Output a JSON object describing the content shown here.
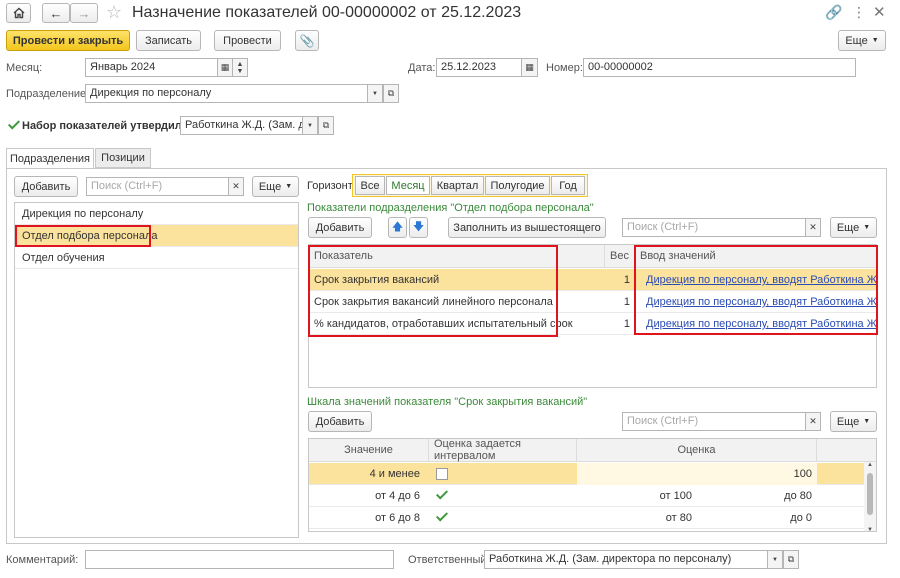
{
  "window": {
    "title": "Назначение показателей 00-00000002 от 25.12.2023"
  },
  "toolbar": {
    "post_close": "Провести и закрыть",
    "save": "Записать",
    "post": "Провести",
    "more": "Еще"
  },
  "header": {
    "month_label": "Месяц:",
    "month_value": "Январь 2024",
    "date_label": "Дата:",
    "date_value": "25.12.2023",
    "number_label": "Номер:",
    "number_value": "00-00000002",
    "department_label": "Подразделение:",
    "department_value": "Дирекция по персоналу",
    "approved_label": "Набор показателей утвердил",
    "approved_value": "Работкина Ж.Д. (Зам. дир",
    "approved_checked": true
  },
  "tabs": [
    "Подразделения",
    "Позиции"
  ],
  "left_panel": {
    "add": "Добавить",
    "search_placeholder": "Поиск (Ctrl+F)",
    "more": "Еще",
    "items": [
      "Дирекция по персоналу",
      "Отдел подбора персонала",
      "Отдел обучения"
    ],
    "selected_index": 1
  },
  "horizon": {
    "label": "Горизонт:",
    "options": [
      "Все",
      "Месяц",
      "Квартал",
      "Полугодие",
      "Год"
    ],
    "selected_index": 1
  },
  "indicators": {
    "title": "Показатели подразделения \"Отдел подбора персонала\"",
    "add": "Добавить",
    "fill": "Заполнить из вышестоящего",
    "search_placeholder": "Поиск (Ctrl+F)",
    "more": "Еще",
    "columns": [
      "Показатель",
      "Вес",
      "Ввод значений"
    ],
    "rows": [
      {
        "name": "Срок закрытия вакансий",
        "weight": "1",
        "entry": "Дирекция по персоналу, вводят Работкина Ж..."
      },
      {
        "name": "Срок закрытия вакансий линейного персонала",
        "weight": "1",
        "entry": "Дирекция по персоналу, вводят Работкина Ж..."
      },
      {
        "name": "% кандидатов, отработавших испытательный срок",
        "weight": "1",
        "entry": "Дирекция по персоналу, вводят Работкина Ж..."
      }
    ]
  },
  "scale": {
    "title": "Шкала значений показателя \"Срок закрытия вакансий\"",
    "add": "Добавить",
    "search_placeholder": "Поиск (Ctrl+F)",
    "more": "Еще",
    "columns": [
      "Значение",
      "Оценка задается интервалом",
      "Оценка"
    ],
    "rows": [
      {
        "value": "4 и менее",
        "interval": false,
        "from": "",
        "to": "100"
      },
      {
        "value": "от 4 до 6",
        "interval": true,
        "from": "от 100",
        "to": "до 80"
      },
      {
        "value": "от 6 до 8",
        "interval": true,
        "from": "от 80",
        "to": "до 0"
      }
    ]
  },
  "footer": {
    "comment_label": "Комментарий:",
    "comment_value": "",
    "responsible_label": "Ответственный:",
    "responsible_value": "Работкина Ж.Д. (Зам. директора по персоналу)"
  },
  "colors": {
    "accent_yellow": "#f3c61c",
    "selection": "#fbe29d",
    "highlight_red": "#e0141e",
    "link": "#2b4cb3",
    "section_green": "#3a8a3a"
  }
}
